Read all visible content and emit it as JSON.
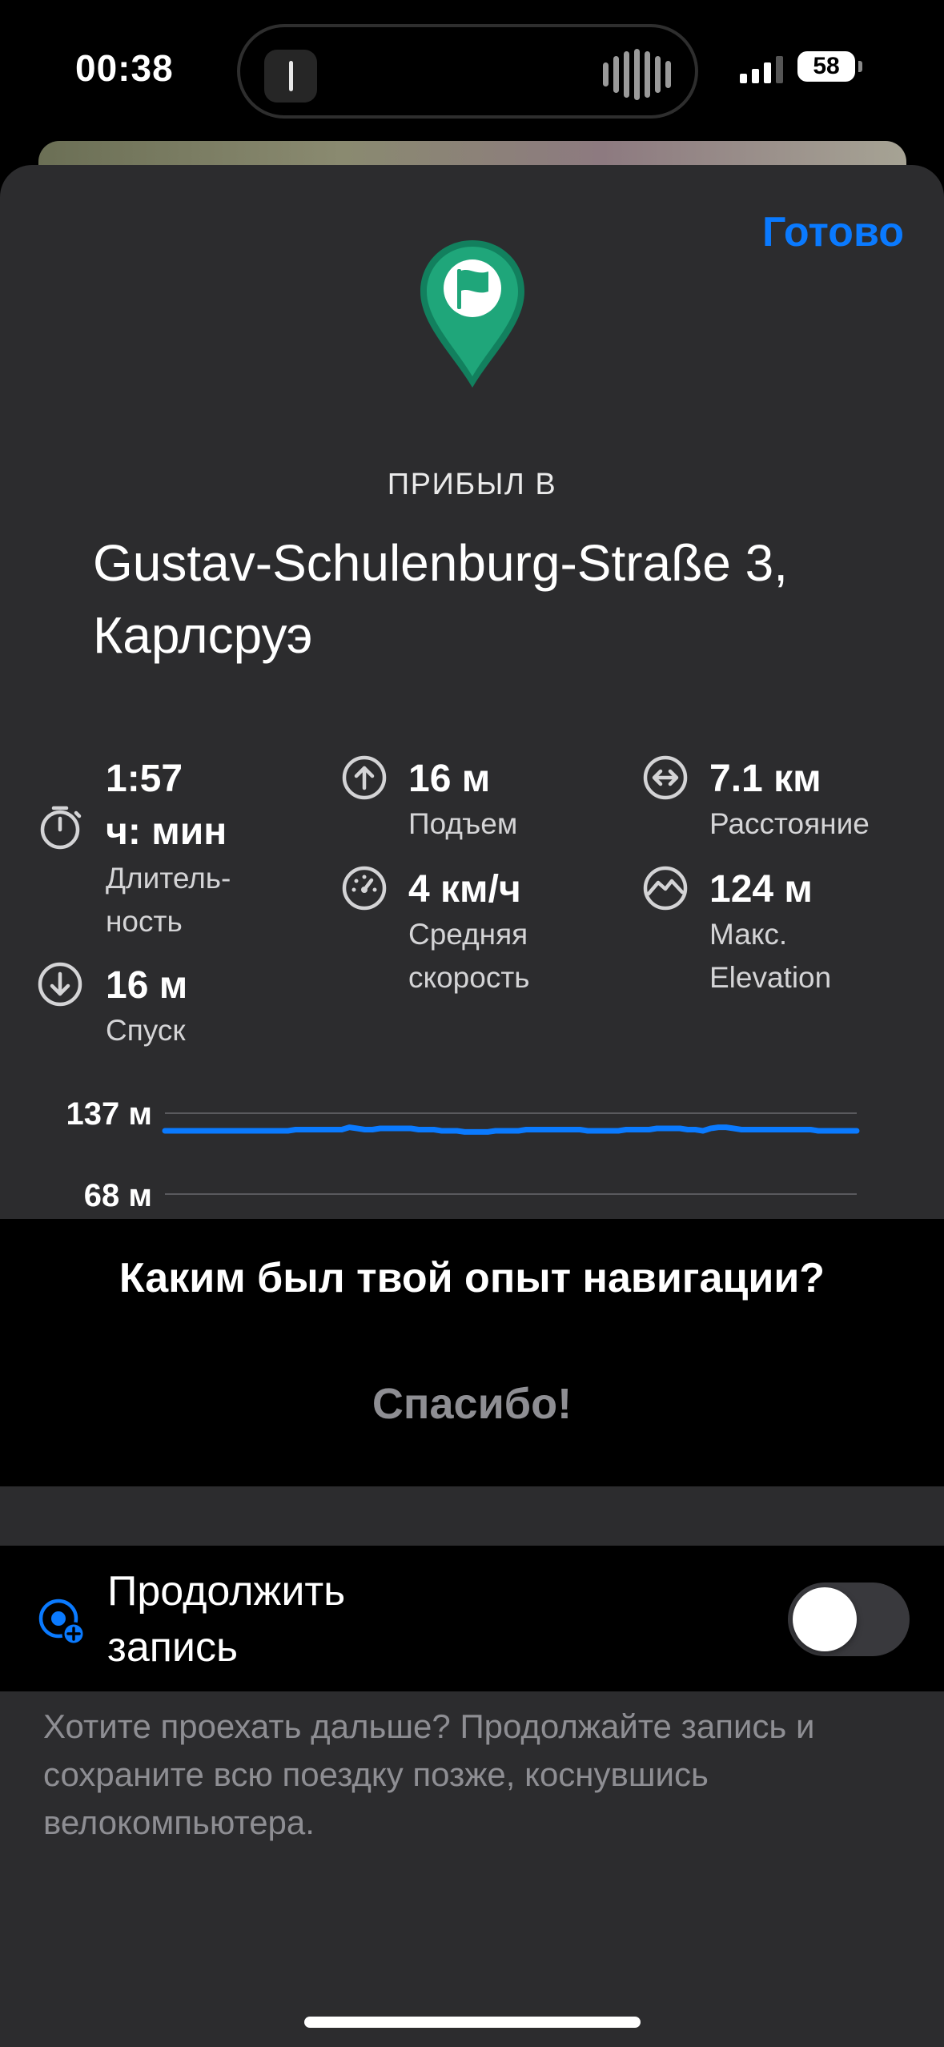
{
  "status": {
    "time": "00:38",
    "battery": "58",
    "island_app_icon": "bike-computer-icon",
    "island_activity_icon": "audio-wave-icon"
  },
  "sheet": {
    "done_label": "Готово",
    "arrived_label": "ПРИБЫЛ В",
    "address": "Gustav-Schulenburg-Straße 3, Карлсруэ",
    "pin_icon": "finish-flag-pin-icon",
    "pin_color": "#1fa67a"
  },
  "stats": {
    "duration": {
      "value_line1": "1:57",
      "value_line2": "ч: мин",
      "label_line1": "Длитель-",
      "label_line2": "ность",
      "icon": "stopwatch-icon"
    },
    "descent": {
      "value": "16 м",
      "label": "Спуск",
      "icon": "arrow-down-circle-icon"
    },
    "ascent": {
      "value": "16 м",
      "label": "Подъем",
      "icon": "arrow-up-circle-icon"
    },
    "avg_speed": {
      "value": "4 км/ч",
      "label_line1": "Средняя",
      "label_line2": "скорость",
      "icon": "speedometer-icon"
    },
    "distance": {
      "value": "7.1 км",
      "label": "Расстояние",
      "icon": "arrows-horizontal-circle-icon"
    },
    "max_elevation": {
      "value": "124 м",
      "label_line1": "Макс.",
      "label_line2": "Elevation",
      "icon": "mountain-circle-icon"
    }
  },
  "chart_data": {
    "type": "line",
    "title": "",
    "xlabel": "",
    "ylabel": "",
    "tick_labels": [
      "137 м",
      "68 м"
    ],
    "y_ticks": [
      137,
      68
    ],
    "ylim": [
      68,
      137
    ],
    "grid": true,
    "line_color": "#0a7aff",
    "series": [
      {
        "values": [
          122,
          122,
          122,
          122,
          122,
          122,
          122,
          122,
          122,
          122,
          122,
          122,
          122,
          122,
          122,
          122,
          122,
          123,
          123,
          123,
          123,
          123,
          123,
          123,
          125,
          124,
          123,
          123,
          124,
          124,
          124,
          124,
          124,
          123,
          123,
          123,
          122,
          122,
          122,
          121,
          121,
          121,
          121,
          122,
          122,
          122,
          122,
          123,
          123,
          123,
          123,
          123,
          123,
          123,
          123,
          122,
          122,
          122,
          122,
          122,
          123,
          123,
          123,
          123,
          124,
          124,
          124,
          124,
          123,
          123,
          122,
          124,
          125,
          125,
          124,
          123,
          123,
          123,
          123,
          123,
          123,
          123,
          123,
          123,
          123,
          122,
          122,
          122,
          122,
          122,
          122
        ]
      }
    ]
  },
  "feedback": {
    "question": "Каким был твой опыт навигации?",
    "thanks": "Спасибо!"
  },
  "continue_recording": {
    "label_line1": "Продолжить",
    "label_line2": "запись",
    "icon": "record-plus-icon",
    "toggle_on": false
  },
  "hint": "Хотите проехать дальше? Продолжайте запись и сохраните всю поездку позже, коснувшись велокомпьютера."
}
